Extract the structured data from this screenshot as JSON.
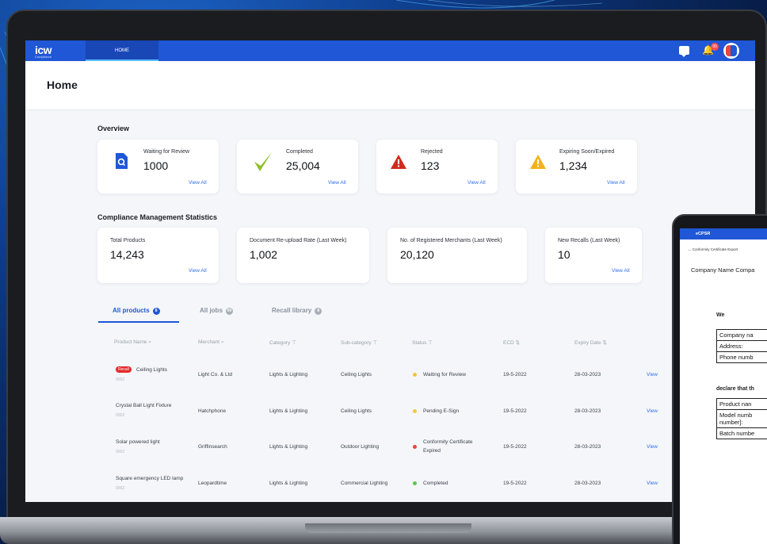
{
  "app": {
    "logo": "icw",
    "logo_sub": "Compliance",
    "nav_tab": "HOME",
    "notification_count": "99",
    "page_title": "Home"
  },
  "overview": {
    "title": "Overview",
    "cards": [
      {
        "label": "Waiting for Review",
        "value": "1000",
        "link": "View All",
        "icon": "document-search-icon",
        "color": "#1f57d6"
      },
      {
        "label": "Completed",
        "value": "25,004",
        "link": "View All",
        "icon": "checkmark-icon",
        "color": "#8fbf2a"
      },
      {
        "label": "Rejected",
        "value": "123",
        "link": "View All",
        "icon": "warning-triangle-icon",
        "color": "#d12b1e"
      },
      {
        "label": "Expiring Soon/Expired",
        "value": "1,234",
        "link": "View All",
        "icon": "warning-triangle-icon",
        "color": "#f2b21c"
      }
    ]
  },
  "stats": {
    "title": "Compliance Management Statistics",
    "cards": [
      {
        "label": "Total Products",
        "value": "14,243",
        "link": "View All"
      },
      {
        "label": "Document Re-upload Rate (Last Week)",
        "value": "1,002",
        "link": ""
      },
      {
        "label": "No. of Registered Merchants (Last Week)",
        "value": "20,120",
        "link": ""
      },
      {
        "label": "New Recalls (Last Week)",
        "value": "10",
        "link": "View All"
      }
    ]
  },
  "tabs": [
    {
      "label": "All products",
      "badge": "8"
    },
    {
      "label": "All jobs",
      "badge": "99"
    },
    {
      "label": "Recall library",
      "badge": "8"
    }
  ],
  "table": {
    "headers": [
      "Product Name",
      "Merchant",
      "Category",
      "Sub-category",
      "Status",
      "ECD",
      "Expiry Date"
    ],
    "recall_label": "Recall",
    "rows": [
      {
        "name": "Ceiling Lights",
        "id": "0002",
        "recall": true,
        "merchant": "Light Co. & Ltd",
        "category": "Lights & Lighting",
        "subcategory": "Ceiling Lights",
        "status": "Waiting for Review",
        "status_extra": "",
        "status_color": "#f5c542",
        "ecd": "19-5-2022",
        "expiry": "28-03-2023",
        "action": "View"
      },
      {
        "name": "Crystal Ball Light Fixture",
        "id": "0002",
        "recall": false,
        "merchant": "Hatchphone",
        "category": "Lights & Lighting",
        "subcategory": "Ceiling Lights",
        "status": "Pending E-Sign",
        "status_extra": "",
        "status_color": "#f5c542",
        "ecd": "19-5-2022",
        "expiry": "28-03-2023",
        "action": "View"
      },
      {
        "name": "Solar powered light",
        "id": "0002",
        "recall": false,
        "merchant": "Griffinsearch",
        "category": "Lights & Lighting",
        "subcategory": "Outdoor Lighting",
        "status": "Conformity Certificate",
        "status_extra": "Expired",
        "status_color": "#e8453c",
        "ecd": "19-5-2022",
        "expiry": "28-03-2023",
        "action": "View"
      },
      {
        "name": "Square emergency LED lamp",
        "id": "0002",
        "recall": false,
        "merchant": "Leopardtime",
        "category": "Lights & Lighting",
        "subcategory": "Commercial Lighting",
        "status": "Completed",
        "status_extra": "",
        "status_color": "#5cc74c",
        "ecd": "19-5-2022",
        "expiry": "28-03-2023",
        "action": "View"
      }
    ]
  },
  "phone": {
    "logo": "eCPSR",
    "crumb": "Conformity Certificate Export",
    "company": "Company Name Compa",
    "we": "We",
    "table1": [
      "Company na",
      "Address:",
      "Phone numb"
    ],
    "declare": "declare that th",
    "table2": [
      "Product nan",
      "Model numb",
      "number]:",
      "Batch numbe"
    ]
  }
}
